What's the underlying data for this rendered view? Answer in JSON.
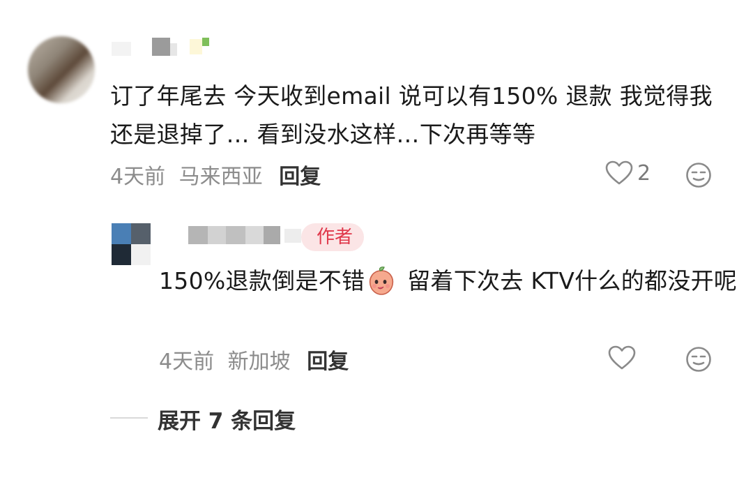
{
  "comment_main": {
    "username": "",
    "text": "订了年尾去 今天收到email 说可以有150% 退款 我觉得我还是退掉了… 看到没水这样…下次再等等",
    "time": "4天前",
    "location": "马来西亚",
    "reply_label": "回复",
    "likes": "2",
    "icons": {
      "like": "heart-outline-icon",
      "dislike": "meh-face-icon"
    }
  },
  "comment_reply": {
    "username": "",
    "author_badge": "作者",
    "text_before_emoji": "150%退款倒是不错",
    "emoji": "peach-emoji",
    "text_after_emoji": " 留着下次去 KTV什么的都没开呢",
    "time": "4天前",
    "location": "新加坡",
    "reply_label": "回复",
    "icons": {
      "like": "heart-outline-icon",
      "dislike": "meh-face-icon"
    }
  },
  "expand_replies": {
    "label": "展开 7 条回复"
  },
  "colors": {
    "text": "#1a1a1a",
    "meta": "#8c8c8c",
    "author_badge_bg": "#fbe5e6",
    "author_badge_text": "#e0384b"
  }
}
